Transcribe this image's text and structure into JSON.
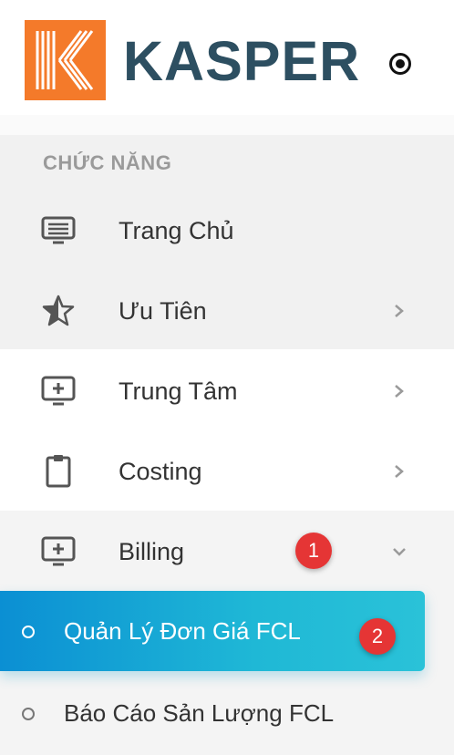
{
  "brand": {
    "name": "KASPER",
    "logo_color": "#f47a2a",
    "name_color": "#2d4f61"
  },
  "section": {
    "title": "CHỨC NĂNG"
  },
  "menu": [
    {
      "label": "Trang Chủ",
      "icon": "monitor-list-icon",
      "chevron": "none"
    },
    {
      "label": "Ưu Tiên",
      "icon": "star-half-icon",
      "chevron": "right"
    },
    {
      "label": "Trung Tâm",
      "icon": "monitor-plus-icon",
      "chevron": "right"
    },
    {
      "label": "Costing",
      "icon": "clipboard-icon",
      "chevron": "right"
    },
    {
      "label": "Billing",
      "icon": "monitor-plus-icon",
      "chevron": "down"
    }
  ],
  "submenu": [
    {
      "label": "Quản Lý Đơn Giá FCL",
      "active": true
    },
    {
      "label": "Báo Cáo Sản Lượng FCL",
      "active": false
    }
  ],
  "badges": [
    "1",
    "2"
  ],
  "colors": {
    "active_start": "#0b8fd3",
    "active_end": "#2ac2d8",
    "badge": "#e53535"
  }
}
